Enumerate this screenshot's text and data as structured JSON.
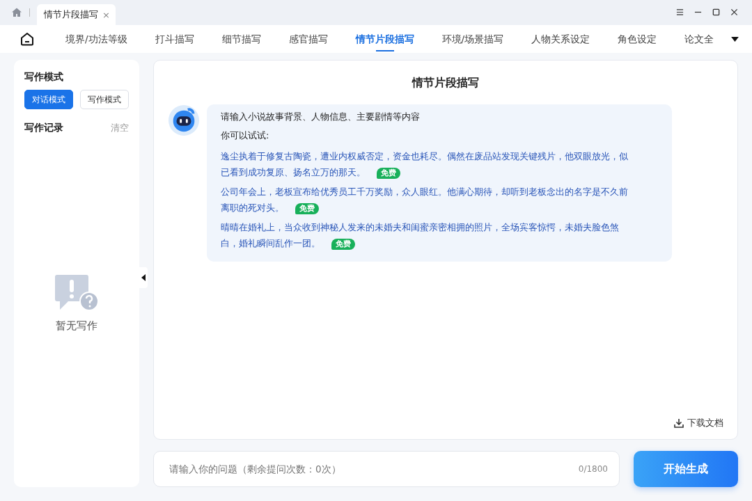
{
  "window": {
    "tab_title": "情节片段描写",
    "tab_close": "×"
  },
  "nav_tabs": [
    {
      "label": "境界/功法等级",
      "selected": false
    },
    {
      "label": "打斗描写",
      "selected": false
    },
    {
      "label": "细节描写",
      "selected": false
    },
    {
      "label": "感官描写",
      "selected": false
    },
    {
      "label": "情节片段描写",
      "selected": true
    },
    {
      "label": "环境/场景描写",
      "selected": false
    },
    {
      "label": "人物关系设定",
      "selected": false
    },
    {
      "label": "角色设定",
      "selected": false
    },
    {
      "label": "论文全",
      "selected": false
    }
  ],
  "sidebar": {
    "mode_title": "写作模式",
    "modes": [
      {
        "label": "对话模式",
        "selected": true
      },
      {
        "label": "写作模式",
        "selected": false
      }
    ],
    "history_title": "写作记录",
    "clear": "清空",
    "empty_text": "暂无写作"
  },
  "main": {
    "title": "情节片段描写",
    "intro": "请输入小说故事背景、人物信息、主要剧情等内容",
    "try_label": "你可以试试:",
    "suggestions": [
      {
        "text": "逸尘执着于修复古陶瓷，遭业内权威否定，资金也耗尽。偶然在废品站发现关键残片，他双眼放光，似已看到成功复原、扬名立万的那天。",
        "badge": "免费"
      },
      {
        "text": "公司年会上，老板宣布给优秀员工千万奖励，众人眼红。他满心期待，却听到老板念出的名字是不久前离职的死对头。",
        "badge": "免费"
      },
      {
        "text": "晴晴在婚礼上，当众收到神秘人发来的未婚夫和闺蜜亲密相拥的照片，全场宾客惊愕，未婚夫脸色煞白，婚礼瞬间乱作一团。",
        "badge": "免费"
      }
    ],
    "download": "下载文档"
  },
  "input": {
    "placeholder": "请输入你的问题（剩余提问次数：0次）",
    "counter": "0/1800",
    "submit": "开始生成"
  }
}
